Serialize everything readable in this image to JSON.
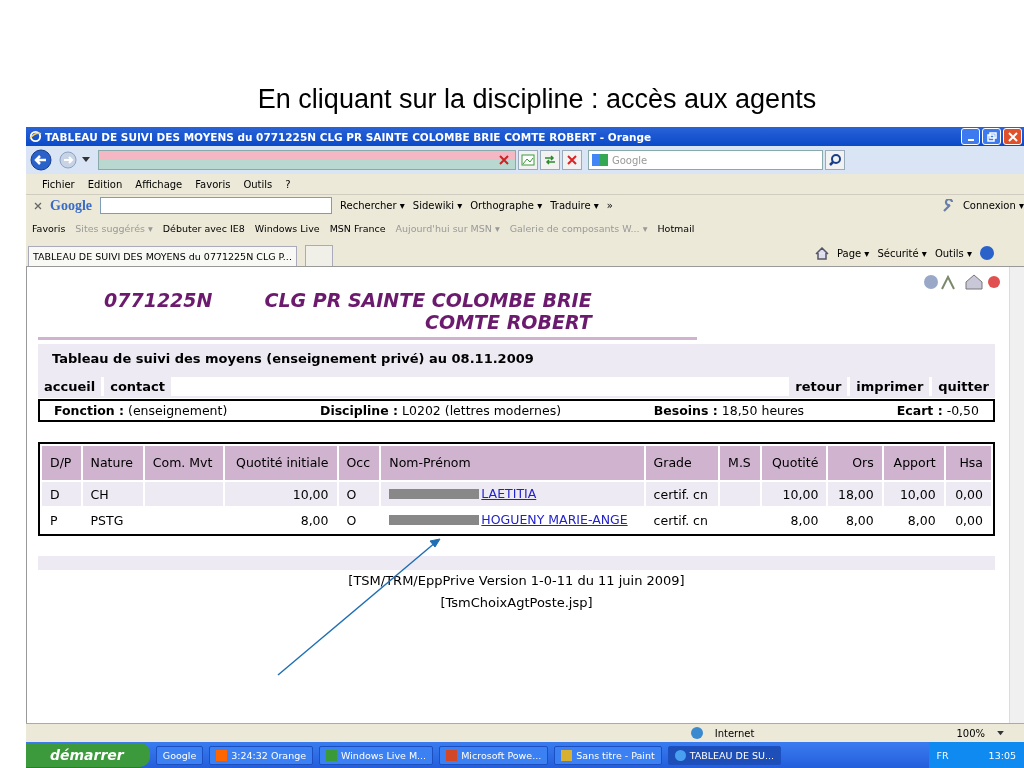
{
  "slide_title": "En cliquant sur la discipline : accès aux agents",
  "window": {
    "title": "TABLEAU DE SUIVI DES MOYENS du 0771225N  CLG PR SAINTE COLOMBE BRIE COMTE ROBERT - Orange",
    "search_placeholder": "Google"
  },
  "menu": [
    "Fichier",
    "Edition",
    "Affichage",
    "Favoris",
    "Outils",
    "?"
  ],
  "google_toolbar": {
    "logo": "Google",
    "items": [
      "Rechercher ▾",
      "Sidewiki ▾",
      "Orthographe ▾",
      "Traduire ▾",
      "»"
    ],
    "connexion": "Connexion ▾"
  },
  "favorites": [
    {
      "label": "Favoris",
      "dim": false
    },
    {
      "label": "Sites suggérés ▾",
      "dim": true
    },
    {
      "label": "Débuter avec IE8",
      "dim": false
    },
    {
      "label": "Windows Live",
      "dim": false
    },
    {
      "label": "MSN France",
      "dim": false
    },
    {
      "label": "Aujourd'hui sur MSN ▾",
      "dim": true
    },
    {
      "label": "Galerie de composants W... ▾",
      "dim": true
    },
    {
      "label": "Hotmail",
      "dim": false
    }
  ],
  "tab": {
    "label": "TABLEAU DE SUIVI DES MOYENS du 0771225N  CLG P..."
  },
  "command_bar": [
    "Page ▾",
    "Sécurité ▾",
    "Outils ▾"
  ],
  "page": {
    "code": "0771225N",
    "school_lines": [
      "CLG PR SAINTE COLOMBE BRIE",
      "COMTE ROBERT"
    ],
    "subtitle": "Tableau de suivi des moyens (enseignement privé) au 08.11.2009",
    "nav_left": [
      "accueil",
      "contact"
    ],
    "nav_right": [
      "retour",
      "imprimer",
      "quitter"
    ],
    "info": [
      {
        "label": "Fonction :",
        "value": "(enseignement)"
      },
      {
        "label": "Discipline :",
        "value": "L0202 (lettres modernes)"
      },
      {
        "label": "Besoins :",
        "value": "18,50 heures"
      },
      {
        "label": "Ecart :",
        "value": "-0,50"
      }
    ],
    "table": {
      "columns": [
        {
          "label": "D/P",
          "kind": "text"
        },
        {
          "label": "Nature",
          "kind": "text"
        },
        {
          "label": "Com. Mvt",
          "kind": "text"
        },
        {
          "label": "Quotité initiale",
          "kind": "number"
        },
        {
          "label": "Occ",
          "kind": "text"
        },
        {
          "label": "Nom-Prénom",
          "kind": "link"
        },
        {
          "label": "Grade",
          "kind": "text"
        },
        {
          "label": "M.S",
          "kind": "text"
        },
        {
          "label": "Quotité",
          "kind": "number"
        },
        {
          "label": "Ors",
          "kind": "number"
        },
        {
          "label": "Apport",
          "kind": "number"
        },
        {
          "label": "Hsa",
          "kind": "number"
        }
      ],
      "rows": [
        {
          "redacted": true,
          "cells": [
            "D",
            "CH",
            "",
            "10,00",
            "O",
            "LAETITIA",
            "certif. cn",
            "",
            "10,00",
            "18,00",
            "10,00",
            "0,00"
          ]
        },
        {
          "redacted": true,
          "cells": [
            "P",
            "PSTG",
            "",
            "8,00",
            "O",
            "HOGUENY MARIE-ANGE",
            "certif. cn",
            "",
            "8,00",
            "8,00",
            "8,00",
            "0,00"
          ]
        }
      ]
    },
    "footer_lines": [
      "[TSM/TRM/EppPrive Version 1-0-11 du 11 juin 2009]",
      "[TsmChoixAgtPoste.jsp]"
    ]
  },
  "status_bar": {
    "zone": "Internet",
    "zoom": "100%"
  },
  "taskbar": {
    "start": "démarrer",
    "items": [
      {
        "label": "Google",
        "kind": "google",
        "selected": false
      },
      {
        "label": "3:24:32 Orange",
        "kind": "orange",
        "selected": false
      },
      {
        "label": "Windows Live M...",
        "kind": "live",
        "selected": false
      },
      {
        "label": "Microsoft Powe...",
        "kind": "ppt",
        "selected": false
      },
      {
        "label": "Sans titre - Paint",
        "kind": "paint",
        "selected": false
      },
      {
        "label": "TABLEAU DE SU...",
        "kind": "ie",
        "selected": true
      }
    ],
    "lang": "FR",
    "clock": "13:05"
  }
}
